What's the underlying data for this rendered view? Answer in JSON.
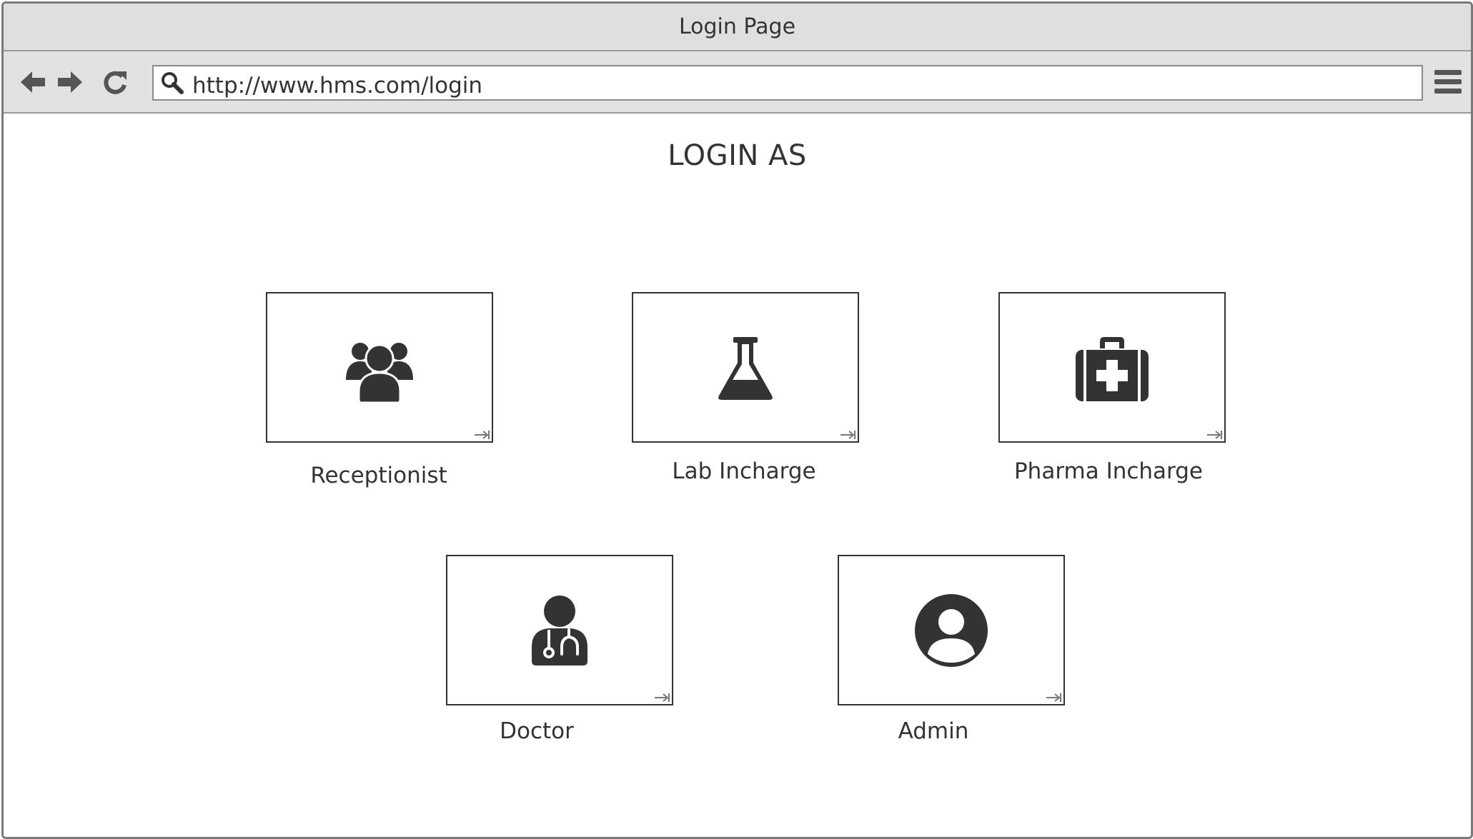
{
  "window": {
    "title": "Login Page"
  },
  "toolbar": {
    "back_icon": "arrow-left-icon",
    "forward_icon": "arrow-right-icon",
    "reload_icon": "reload-icon",
    "url": "http://www.hms.com/login",
    "search_icon": "search-icon",
    "menu_icon": "hamburger-menu-icon"
  },
  "page": {
    "heading": "LOGIN AS",
    "roles": [
      {
        "label": "Receptionist",
        "icon": "users-group-icon"
      },
      {
        "label": "Lab Incharge",
        "icon": "flask-icon"
      },
      {
        "label": "Pharma Incharge",
        "icon": "medical-kit-icon"
      },
      {
        "label": "Doctor",
        "icon": "doctor-icon"
      },
      {
        "label": "Admin",
        "icon": "user-circle-icon"
      }
    ]
  },
  "colors": {
    "icon": "#333333",
    "chrome": "#dfdfdf",
    "border": "#7a7a7a"
  }
}
